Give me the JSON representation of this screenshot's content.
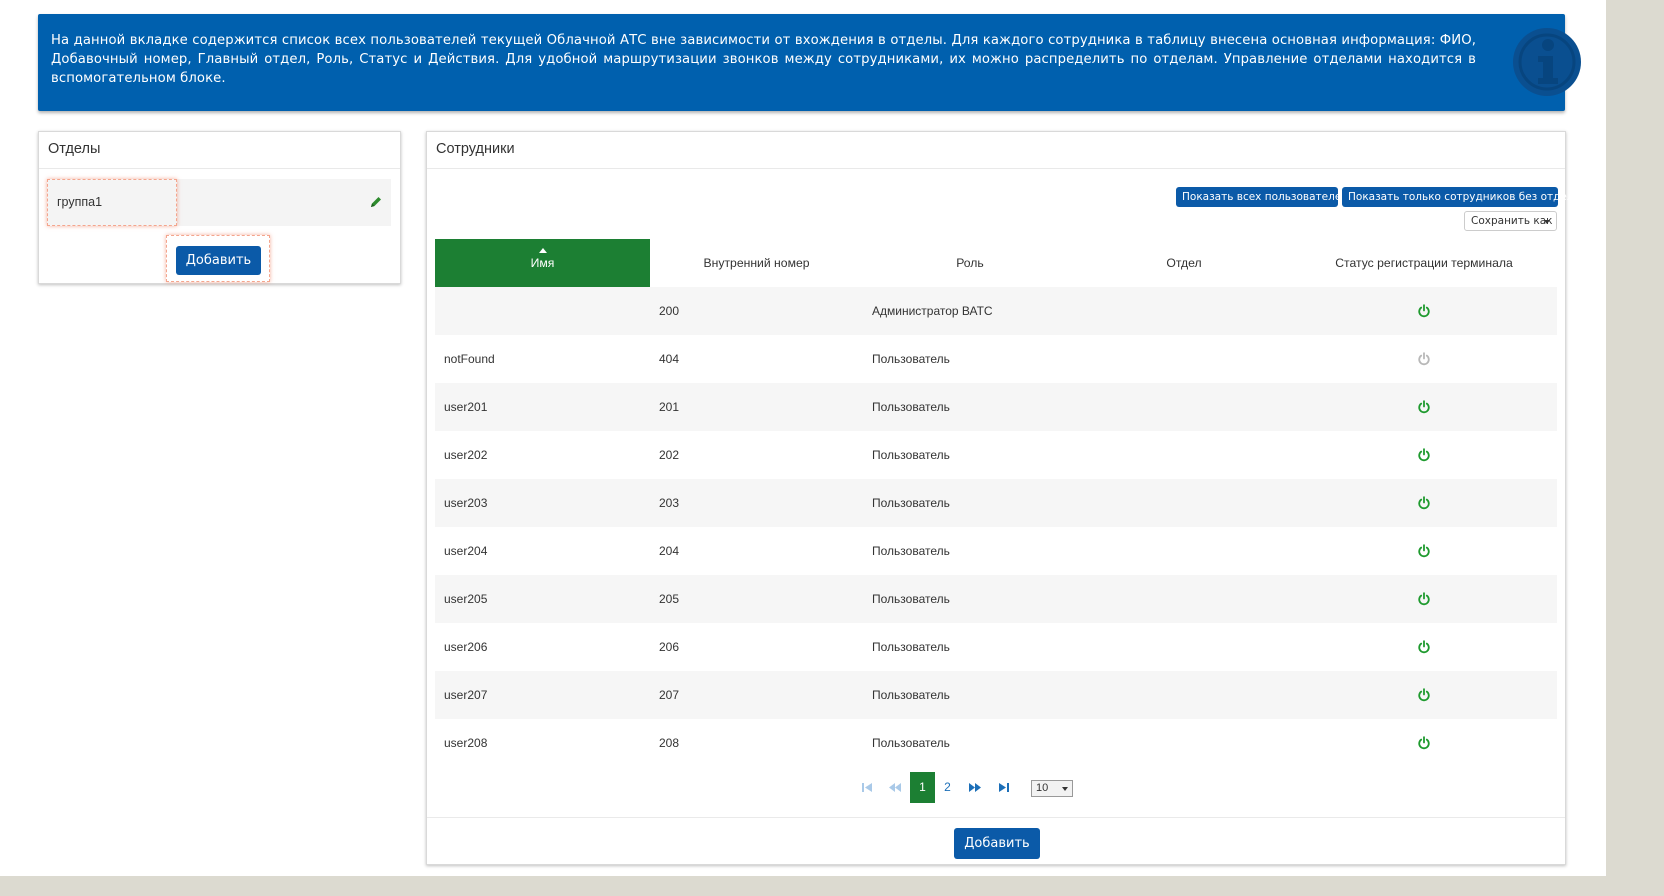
{
  "info": {
    "text": "На данной вкладке содержится список всех пользователей текущей Облачной АТС вне зависимости от вхождения в отделы. Для каждого сотрудника в таблицу внесена основная информация: ФИО, Добавочный номер, Главный отдел, Роль, Статус и Действия. Для удобной маршрутизации звонков между сотрудниками, их можно распределить по отделам. Управление отделами находится в вспомогательном блоке.",
    "icon": "info-icon"
  },
  "departments": {
    "title": "Отделы",
    "items": [
      {
        "name": "группа1"
      }
    ],
    "add_label": "Добавить"
  },
  "employees": {
    "title": "Сотрудники",
    "show_all_label": "Показать всех пользователей",
    "show_no_dept_label": "Показать только сотрудников без отдела",
    "save_as_label": "Сохранить как",
    "columns": [
      "Имя",
      "Внутренний номер",
      "Роль",
      "Отдел",
      "Статус регистрации терминала"
    ],
    "sorted_column": "Имя",
    "rows": [
      {
        "name": "",
        "ext": "200",
        "role": "Администратор ВАТС",
        "dept": "",
        "status": "online"
      },
      {
        "name": "notFound",
        "ext": "404",
        "role": "Пользователь",
        "dept": "",
        "status": "offline"
      },
      {
        "name": "user201",
        "ext": "201",
        "role": "Пользователь",
        "dept": "",
        "status": "online"
      },
      {
        "name": "user202",
        "ext": "202",
        "role": "Пользователь",
        "dept": "",
        "status": "online"
      },
      {
        "name": "user203",
        "ext": "203",
        "role": "Пользователь",
        "dept": "",
        "status": "online"
      },
      {
        "name": "user204",
        "ext": "204",
        "role": "Пользователь",
        "dept": "",
        "status": "online"
      },
      {
        "name": "user205",
        "ext": "205",
        "role": "Пользователь",
        "dept": "",
        "status": "online"
      },
      {
        "name": "user206",
        "ext": "206",
        "role": "Пользователь",
        "dept": "",
        "status": "online"
      },
      {
        "name": "user207",
        "ext": "207",
        "role": "Пользователь",
        "dept": "",
        "status": "online"
      },
      {
        "name": "user208",
        "ext": "208",
        "role": "Пользователь",
        "dept": "",
        "status": "online"
      }
    ],
    "pagination": {
      "pages": [
        "1",
        "2"
      ],
      "current": "1",
      "page_size": "10"
    },
    "add_label": "Добавить"
  },
  "colors": {
    "banner": "#0060ae",
    "accent_green": "#1c7f33",
    "button_blue": "#0b5aa8",
    "status_online": "#1e9a2e",
    "status_offline": "#b8b8b8"
  }
}
